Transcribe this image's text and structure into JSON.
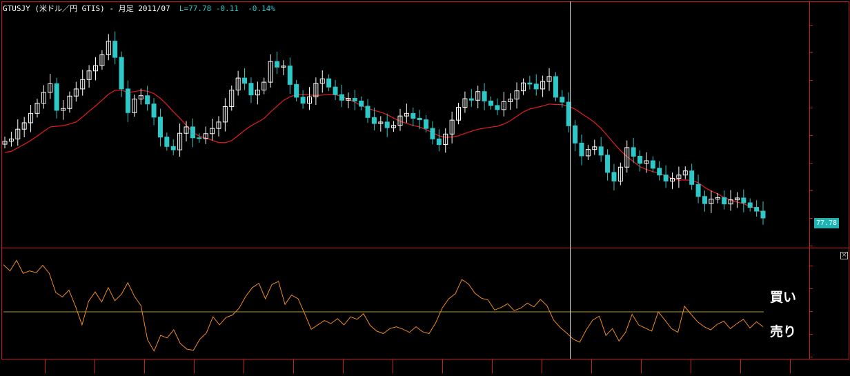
{
  "header": {
    "symbol": "GTUSJY",
    "title_prefix": "GTUSJY (米ドル／円 GTIS) - 月足 2011/07",
    "last": "L=77.78",
    "change": "-0.11",
    "change_pct": "-0.14%"
  },
  "price_tag": "77.78",
  "signals": {
    "buy": "買い",
    "sell": "売り"
  },
  "colors": {
    "background": "#000000",
    "frame": "#c81e1e",
    "up_candle": "#ffffff",
    "down_candle": "#2ec8c8",
    "moving_average": "#e61e1e",
    "oscillator": "#f08a24",
    "signal_line": "#b4a028",
    "crosshair": "#d8d8d8",
    "price_tag_bg": "#1fb4b4"
  },
  "icons": {
    "close": "close-icon"
  },
  "chart_data": [
    {
      "type": "candlestick",
      "title": "GTUSJY (米ドル／円 GTIS) - 月足 2011/07",
      "last_price": 77.78,
      "close_series": [
        98.2,
        98.8,
        101.4,
        103.1,
        105.6,
        108.3,
        111.2,
        113.5,
        106.4,
        106.9,
        110.2,
        112.1,
        114.6,
        116.9,
        118.3,
        121.2,
        124.8,
        120.5,
        112.1,
        105.8,
        109.4,
        110.3,
        108.1,
        104.6,
        99.3,
        96.8,
        95.9,
        100.3,
        102.0,
        99.1,
        98.9,
        100.2,
        101.6,
        103.3,
        107.4,
        111.8,
        115.0,
        113.6,
        110.5,
        111.8,
        113.9,
        119.4,
        117.9,
        118.2,
        113.3,
        109.9,
        108.3,
        110.0,
        113.6,
        114.8,
        112.6,
        110.6,
        109.1,
        109.6,
        108.9,
        107.5,
        104.5,
        102.9,
        103.3,
        101.8,
        102.4,
        104.9,
        105.6,
        104.3,
        103.9,
        101.6,
        98.8,
        97.3,
        100.1,
        103.8,
        107.2,
        109.5,
        109.1,
        111.4,
        108.9,
        107.7,
        106.6,
        108.7,
        109.4,
        111.6,
        113.7,
        113.4,
        112.1,
        114.1,
        115.4,
        109.9,
        108.6,
        102.3,
        97.7,
        94.3,
        96.0,
        96.7,
        94.5,
        89.9,
        87.6,
        91.3,
        96.5,
        94.2,
        92.3,
        93.0,
        91.0,
        89.2,
        87.6,
        88.3,
        89.2,
        90.3,
        86.7,
        83.5,
        81.6,
        82.8,
        83.2,
        81.5,
        82.6,
        83.1,
        81.8,
        80.6,
        79.6,
        77.78
      ],
      "moving_average_label": "",
      "oscillator": {
        "values": [
          76,
          66,
          83,
          62,
          66,
          63,
          75,
          62,
          31,
          24,
          35,
          9,
          -21,
          17,
          32,
          16,
          39,
          18,
          28,
          47,
          25,
          10,
          -45,
          -63,
          -38,
          -42,
          -29,
          -51,
          -60,
          -62,
          -44,
          -34,
          -8,
          -21,
          -9,
          -5,
          6,
          25,
          39,
          46,
          21,
          44,
          49,
          12,
          27,
          21,
          -3,
          -28,
          -21,
          -14,
          -19,
          -11,
          -21,
          -8,
          -12,
          -3,
          -22,
          -31,
          -35,
          -27,
          -24,
          -28,
          -33,
          -24,
          -32,
          -35,
          -18,
          6,
          21,
          29,
          52,
          45,
          30,
          22,
          19,
          3,
          7,
          13,
          2,
          6,
          14,
          8,
          20,
          10,
          -13,
          -25,
          -34,
          -44,
          -49,
          -29,
          -13,
          -7,
          -38,
          -27,
          -47,
          -33,
          -4,
          -21,
          -26,
          -31,
          0,
          -13,
          -27,
          -33,
          9,
          -4,
          -16,
          -24,
          -29,
          -20,
          -15,
          -27,
          -19,
          -12,
          -26,
          -16,
          -24
        ],
        "signal_level": 0
      }
    }
  ]
}
